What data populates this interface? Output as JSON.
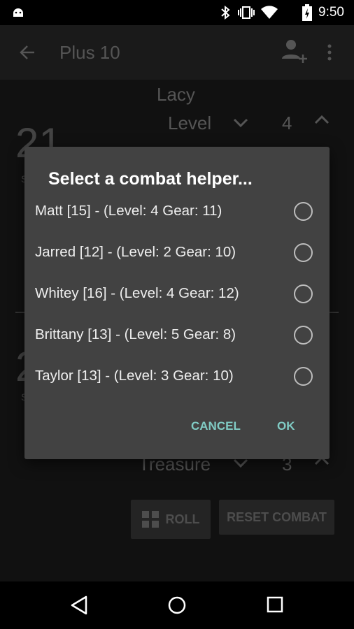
{
  "status_bar": {
    "time": "9:50",
    "icons": [
      "android-debug-icon",
      "bluetooth-icon",
      "vibrate-icon",
      "wifi-icon",
      "battery-charging-icon"
    ]
  },
  "app_bar": {
    "title": "Plus 10",
    "icons": [
      "back-arrow-icon",
      "add-person-icon",
      "overflow-menu-icon"
    ]
  },
  "background": {
    "player_name": "Lacy",
    "level_label": "Level",
    "level_value": "4",
    "strength_1": "21",
    "strength_label_1": "S",
    "strength_2": "2",
    "strength_label_2": "S",
    "treasure_label": "Treasure",
    "treasure_value": "3",
    "roll_label": "ROLL",
    "reset_label": "RESET COMBAT"
  },
  "dialog": {
    "title": "Select a combat helper...",
    "options": [
      {
        "label": "Matt [15] - (Level: 4 Gear: 11)",
        "selected": false
      },
      {
        "label": "Jarred [12] - (Level: 2 Gear: 10)",
        "selected": false
      },
      {
        "label": "Whitey [16] - (Level: 4 Gear: 12)",
        "selected": false
      },
      {
        "label": "Brittany [13] - (Level: 5 Gear: 8)",
        "selected": false
      },
      {
        "label": "Taylor [13] - (Level: 3 Gear: 10)",
        "selected": false
      }
    ],
    "cancel_label": "CANCEL",
    "ok_label": "OK",
    "accent": "#80cbc4"
  }
}
